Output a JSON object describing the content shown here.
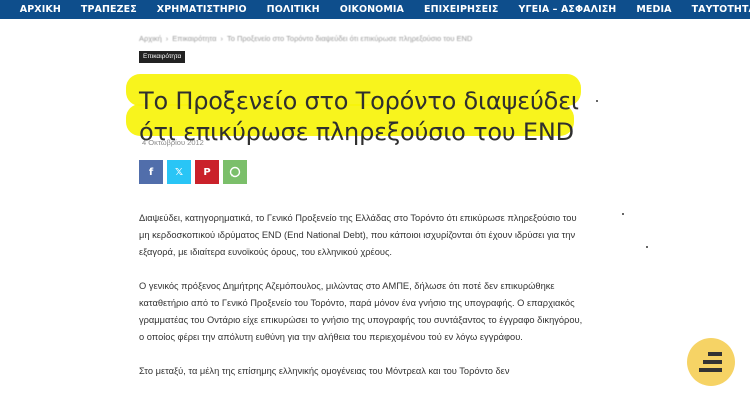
{
  "nav": {
    "items": [
      "ΑΡΧΙΚΗ",
      "ΤΡΑΠΕΖΕΣ",
      "ΧΡΗΜΑΤΙΣΤΗΡΙΟ",
      "ΠΟΛΙΤΙΚΗ",
      "ΟΙΚΟΝΟΜΙΑ",
      "ΕΠΙΧΕΙΡΗΣΕΙΣ",
      "ΥΓΕΙΑ – ΑΣΦΑΛΙΣΗ",
      "MEDIA",
      "ΤΑΥΤΟΤΗΤΑ"
    ]
  },
  "breadcrumb": {
    "home": "Αρχική",
    "section": "Επικαιρότητα",
    "current": "Το Προξενείο στο Τορόντο διαψεύδει ότι επικύρωσε πληρεξούσιο του END"
  },
  "article": {
    "category": "Επικαιρότητα",
    "title_line1": "Το Προξενείο στο Τορόντο διαψεύδει",
    "title_line2": "ότι επικύρωσε πληρεξούσιο του END",
    "date": "4 Οκτωβρίου 2012",
    "highlight_color": "#f7f30a",
    "paragraphs": [
      "Διαψεύδει, κατηγορηματικά, το Γενικό Προξενείο της Ελλάδας στο Τορόντο ότι επικύρωσε πληρεξούσιο του μη κερδοσκοπικού ιδρύματος END (End National Debt), που κάποιοι ισχυρίζονται ότι έχουν ιδρύσει για την εξαγορά, με ιδιαίτερα ευνοϊκούς όρους, του ελληνικού χρέους.",
      "Ο γενικός πρόξενος Δημήτρης Αζεμόπουλος, μιλώντας στο ΑΜΠΕ, δήλωσε ότι ποτέ δεν επικυρώθηκε καταθετήριο από το Γενικό Προξενείο του Τορόντο, παρά μόνον ένα γνήσιο της υπογραφής. Ο επαρχιακός γραμματέας του Οντάριο είχε επικυρώσει το γνήσιο της υπογραφής του συντάξαντος το έγγραφο δικηγόρου, ο οποίος φέρει την απόλυτη ευθύνη για την αλήθεια του περιεχομένου τού εν λόγω εγγράφου.",
      "Στο μεταξύ, τα μέλη της επίσημης ελληνικής ομογένειας του Μόντρεαλ και του Τορόντο δεν"
    ]
  },
  "share": {
    "facebook_icon": "facebook-icon",
    "twitter_icon": "x-twitter-icon",
    "pinterest_icon": "pinterest-icon",
    "whatsapp_icon": "whatsapp-icon",
    "colors": {
      "facebook": "#516eab",
      "twitter": "#29c5f6",
      "pinterest": "#ca212a",
      "whatsapp": "#7bbf6a"
    }
  },
  "fab": {
    "icon": "stacked-bars-icon",
    "color": "#f6d365"
  }
}
